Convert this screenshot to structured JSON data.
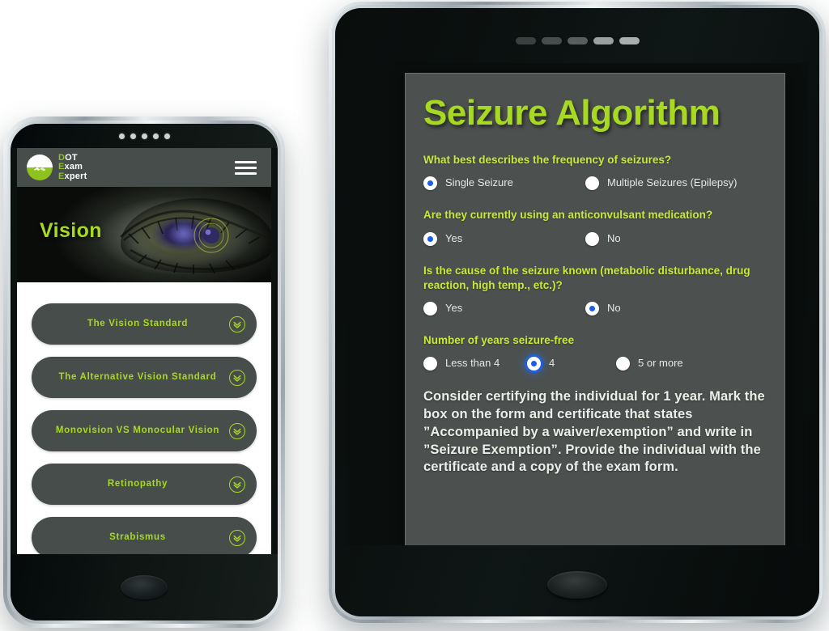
{
  "phone": {
    "header": {
      "logo_icon": "handshake-circle-logo",
      "logo_lines": [
        {
          "accent": "D",
          "rest": "OT"
        },
        {
          "accent": "E",
          "rest": "xam"
        },
        {
          "accent": "E",
          "rest": "xpert"
        }
      ],
      "menu_icon": "hamburger-menu-icon"
    },
    "hero": {
      "title": "Vision",
      "image_alt": "eye-with-cybernetic-iris"
    },
    "accordion_items": [
      {
        "label": "The Vision Standard",
        "icon": "double-chevron-down-icon"
      },
      {
        "label": "The Alternative Vision Standard",
        "icon": "double-chevron-down-icon"
      },
      {
        "label": "Monovision VS Monocular Vision",
        "icon": "double-chevron-down-icon"
      },
      {
        "label": "Retinopathy",
        "icon": "double-chevron-down-icon"
      },
      {
        "label": "Strabismus",
        "icon": "double-chevron-down-icon"
      }
    ],
    "bezel_dot_count": 5
  },
  "tablet": {
    "speaker_pill_count": 5,
    "card": {
      "title": "Seizure Algorithm",
      "questions": [
        {
          "text": "What best describes the frequency of seizures?",
          "options": [
            {
              "label": "Single Seizure",
              "selected": true,
              "focused": false
            },
            {
              "label": "Multiple Seizures (Epilepsy)",
              "selected": false,
              "focused": false
            }
          ]
        },
        {
          "text": "Are they currently using an anticonvulsant medication?",
          "options": [
            {
              "label": "Yes",
              "selected": true,
              "focused": false
            },
            {
              "label": "No",
              "selected": false,
              "focused": false
            }
          ]
        },
        {
          "text": "Is the cause of the seizure known (metabolic disturbance, drug reaction, high temp., etc.)?",
          "options": [
            {
              "label": "Yes",
              "selected": false,
              "focused": false
            },
            {
              "label": "No",
              "selected": true,
              "focused": false
            }
          ]
        },
        {
          "text": "Number of years seizure-free",
          "options": [
            {
              "label": "Less than 4",
              "selected": false,
              "focused": false
            },
            {
              "label": "4",
              "selected": true,
              "focused": true
            },
            {
              "label": "5 or more",
              "selected": false,
              "focused": false
            }
          ]
        }
      ],
      "result": "Consider certifying the individual for 1 year. Mark the box on the form and certificate that states ”Accompanied by a waiver/exemption” and write in ”Seizure Exemption”. Provide the individual with the certificate and a copy of the exam form."
    }
  },
  "colors": {
    "brand_green": "#a8d922",
    "question_green": "#c9e83a",
    "card_gray": "#4c514f",
    "radio_blue": "#1a5fe0",
    "text_light": "#e6e9e4"
  }
}
